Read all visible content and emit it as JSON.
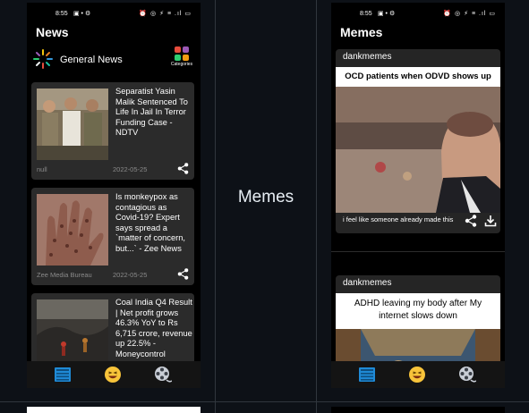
{
  "grid": {
    "middle_label": "Memes"
  },
  "news_phone": {
    "status": {
      "time": "8:55",
      "badges": "▣ • ⚙",
      "icons": "⏰ ◎ ⚡ ≡ .ıl ▭"
    },
    "title": "News",
    "category_row": {
      "label": "General News",
      "categories_label": "Categories"
    },
    "articles": [
      {
        "headline": "Separatist Yasin Malik Sentenced To Life In Jail In Terror Funding Case - NDTV",
        "source": "null",
        "date": "2022-05-25"
      },
      {
        "headline": "Is monkeypox as contagious as Covid-19? Expert says spread a `matter of concern, but...` - Zee News",
        "source": "Zee Media Bureau",
        "date": "2022-05-25"
      },
      {
        "headline": "Coal India Q4 Result | Net profit grows 46.3% YoY to Rs 6,715 crore, revenue up 22.5% - Moneycontrol",
        "source": "",
        "date": ""
      }
    ],
    "nav": [
      "news-tab",
      "memes-tab",
      "movies-tab"
    ]
  },
  "memes_phone": {
    "status": {
      "time": "8:55",
      "badges": "▣ • ⚙",
      "icons": "⏰ ◎ ⚡ ≡ .ıl ▭"
    },
    "title": "Memes",
    "memes": [
      {
        "subreddit": "dankmemes",
        "top_text": "OCD patients when ODVD shows up",
        "caption": "i feel like someone already made this"
      },
      {
        "subreddit": "dankmemes",
        "top_text": "ADHD leaving my body after My internet slows down",
        "caption": ""
      }
    ]
  },
  "colors": {
    "background": "#0d1117",
    "card": "#2b2b2b",
    "accent_blue": "#1f8ad6",
    "emoji_yellow": "#f8c43a"
  }
}
